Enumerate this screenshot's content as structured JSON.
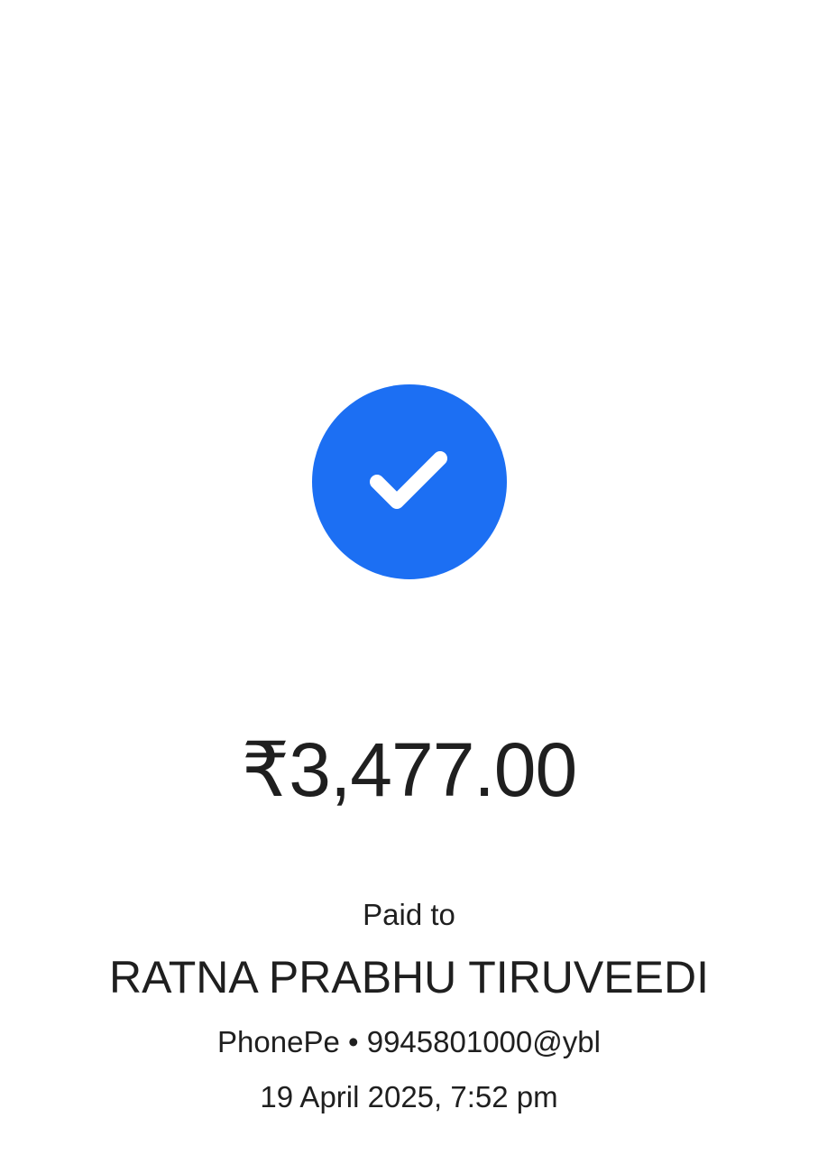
{
  "status": {
    "icon": "check-circle-icon",
    "color": "#1c6ff3"
  },
  "payment": {
    "amount": "₹3,477.00",
    "paid_to_label": "Paid to",
    "payee_name": "RATNA PRABHU TIRUVEEDI",
    "payee_details": "PhonePe • 9945801000@ybl",
    "timestamp": "19 April 2025, 7:52 pm"
  }
}
